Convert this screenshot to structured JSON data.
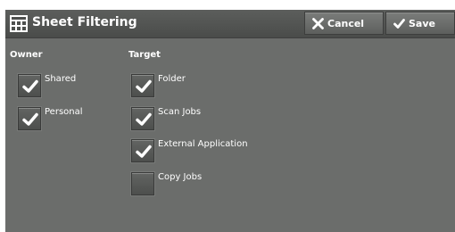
{
  "header": {
    "title": "Sheet Filtering",
    "title_icon": "sheet-filter-icon",
    "cancel_label": "Cancel",
    "save_label": "Save"
  },
  "owner": {
    "label": "Owner",
    "options": [
      {
        "label": "Shared",
        "checked": true
      },
      {
        "label": "Personal",
        "checked": true
      }
    ]
  },
  "target": {
    "label": "Target",
    "options": [
      {
        "label": "Folder",
        "checked": true
      },
      {
        "label": "Scan Jobs",
        "checked": true
      },
      {
        "label": "External Application",
        "checked": true
      },
      {
        "label": "Copy Jobs",
        "checked": false
      }
    ]
  },
  "colors": {
    "background": "#6b6d6b",
    "titlebar": "#4d4f4d",
    "text": "#ffffff"
  }
}
